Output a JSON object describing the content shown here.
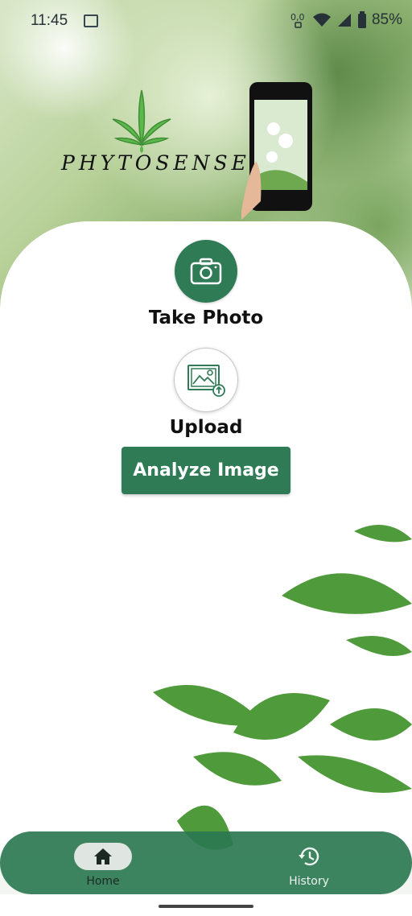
{
  "status_bar": {
    "time": "11:45",
    "battery_percent": "85%",
    "icons": [
      "gallery-icon",
      "data-icon",
      "wifi-icon",
      "signal-icon",
      "battery-icon"
    ]
  },
  "brand": {
    "name": "PHYTOSENSE",
    "logo_icon": "cannabis-leaf-icon"
  },
  "main": {
    "take_photo_label": "Take Photo",
    "upload_label": "Upload",
    "analyze_button_label": "Analyze Image"
  },
  "bottom_nav": {
    "items": [
      {
        "label": "Home",
        "icon": "home-icon",
        "selected": true
      },
      {
        "label": "History",
        "icon": "history-icon",
        "selected": false
      }
    ]
  },
  "colors": {
    "primary_green": "#2f7b56",
    "nav_pill": "#dfe6e2",
    "text": "#111111"
  }
}
